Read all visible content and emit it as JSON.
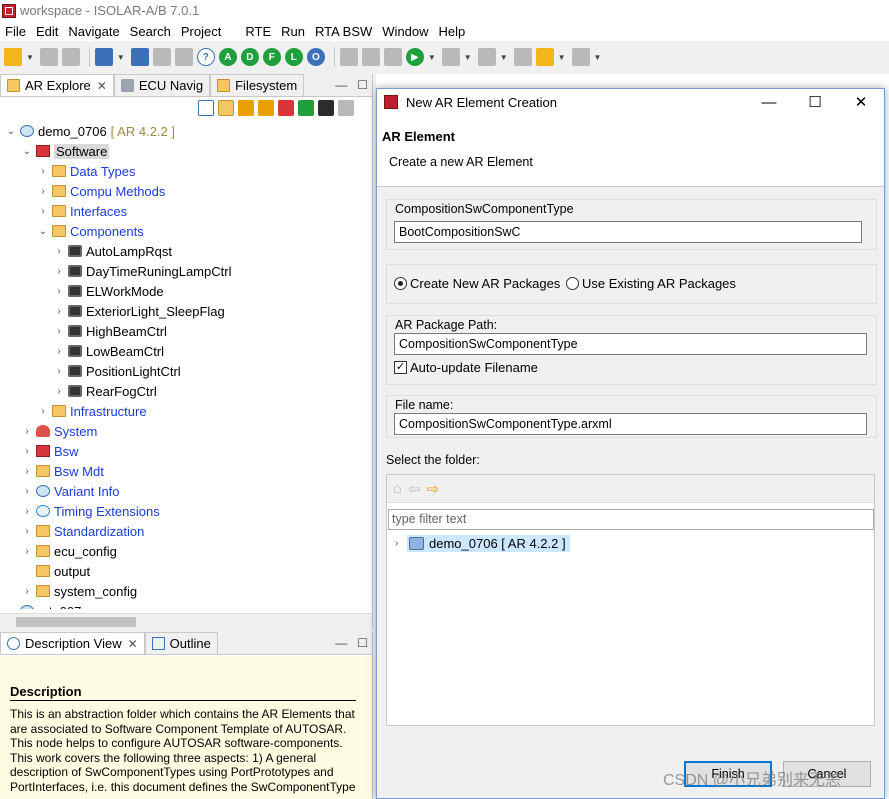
{
  "window": {
    "title": "workspace - ISOLAR-A/B 7.0.1"
  },
  "menu": [
    "File",
    "Edit",
    "Navigate",
    "Search",
    "Project",
    "RTE",
    "Run",
    "RTA BSW",
    "Window",
    "Help"
  ],
  "toolbar": {
    "letters": [
      "A",
      "D",
      "F",
      "L",
      "O"
    ]
  },
  "explorer": {
    "tabs": [
      {
        "label": "AR Explore",
        "close": "✕"
      },
      {
        "label": "ECU Navig"
      },
      {
        "label": "Filesystem"
      }
    ],
    "tree": [
      {
        "label": "demo_0706",
        "suffix": "[ AR 4.2.2 ]",
        "level": 0,
        "expanded": true,
        "icon": "project-icon"
      },
      {
        "label": "Software",
        "level": 1,
        "expanded": true,
        "icon": "package-red-icon",
        "highlight": true
      },
      {
        "label": "Data Types",
        "level": 2,
        "icon": "folder-icon",
        "link": true
      },
      {
        "label": "Compu Methods",
        "level": 2,
        "icon": "folder-icon",
        "link": true
      },
      {
        "label": "Interfaces",
        "level": 2,
        "icon": "folder-icon",
        "link": true
      },
      {
        "label": "Components",
        "level": 2,
        "expanded": true,
        "icon": "folder-icon",
        "link": true
      },
      {
        "label": "AutoLampRqst",
        "level": 3,
        "icon": "component-icon"
      },
      {
        "label": "DayTimeRuningLampCtrl",
        "level": 3,
        "icon": "component-icon"
      },
      {
        "label": "ELWorkMode",
        "level": 3,
        "icon": "component-icon"
      },
      {
        "label": "ExteriorLight_SleepFlag",
        "level": 3,
        "icon": "component-icon"
      },
      {
        "label": "HighBeamCtrl",
        "level": 3,
        "icon": "component-icon"
      },
      {
        "label": "LowBeamCtrl",
        "level": 3,
        "icon": "component-icon"
      },
      {
        "label": "PositionLightCtrl",
        "level": 3,
        "icon": "component-icon"
      },
      {
        "label": "RearFogCtrl",
        "level": 3,
        "icon": "component-icon"
      },
      {
        "label": "Infrastructure",
        "level": 2,
        "icon": "folder-icon",
        "link": true
      },
      {
        "label": "System",
        "level": 1,
        "icon": "system-icon",
        "link": true
      },
      {
        "label": "Bsw",
        "level": 1,
        "icon": "bsw-icon",
        "link": true
      },
      {
        "label": "Bsw Mdt",
        "level": 1,
        "icon": "folder-icon",
        "link": true
      },
      {
        "label": "Variant Info",
        "level": 1,
        "icon": "globe-icon",
        "link": true
      },
      {
        "label": "Timing Extensions",
        "level": 1,
        "icon": "clock-icon",
        "link": true
      },
      {
        "label": "Standardization",
        "level": 1,
        "icon": "folder-icon",
        "link": true
      },
      {
        "label": "ecu_config",
        "level": 1,
        "icon": "folder-open-icon"
      },
      {
        "label": "output",
        "level": 1,
        "icon": "folder-open-icon",
        "leaf": true
      },
      {
        "label": "system_config",
        "level": 1,
        "icon": "folder-open-icon"
      },
      {
        "label": "...t_007",
        "level": 0,
        "icon": "project-icon",
        "cut": true
      }
    ]
  },
  "description": {
    "tabs": [
      {
        "label": "Description View",
        "close": "✕"
      },
      {
        "label": "Outline"
      }
    ],
    "heading": "Description",
    "text": "This is an abstraction folder which contains the AR Elements that are associated to Software Component Template of AUTOSAR. This node helps to configure AUTOSAR software-components. This work covers the following three aspects: 1) A general description of SwComponentTypes using PortPrototypes and PortInterfaces, i.e. this document defines the SwComponentType"
  },
  "dialog": {
    "title": "New AR Element Creation",
    "banner_title": "AR Element",
    "banner_subtitle": "Create a new AR Element",
    "type_label": "CompositionSwComponentType",
    "type_value": "BootCompositionSwC",
    "radio_new": "Create New AR Packages",
    "radio_existing": "Use Existing AR Packages",
    "package_path_label": "AR Package Path:",
    "package_path_value": "CompositionSwComponentType",
    "auto_update_label": "Auto-update Filename",
    "file_name_label": "File name:",
    "file_name_value": "CompositionSwComponentType.arxml",
    "folder_label": "Select the folder:",
    "filter_placeholder": "type filter text",
    "folder_node": "demo_0706 [ AR 4.2.2 ]",
    "finish": "Finish",
    "cancel": "Cancel"
  },
  "watermark": "CSDN @小兄弟别来无恙"
}
